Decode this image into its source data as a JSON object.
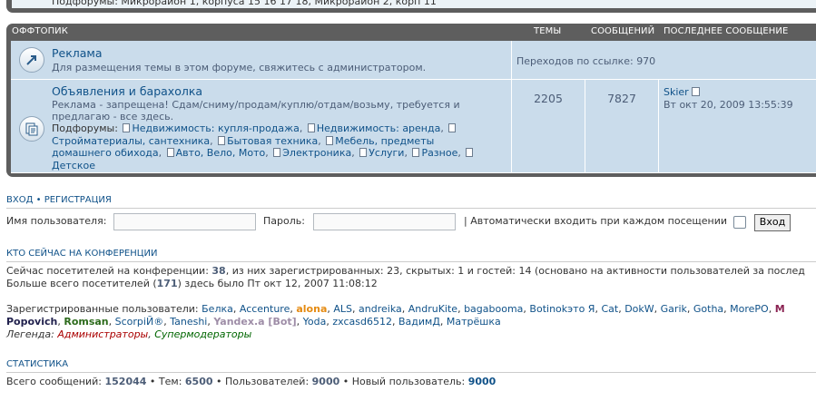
{
  "top_remnant": {
    "text": "Подфорумы:  Микрорайон 1, корпуса 15 16 17 18,  Микрорайон 2, корп 11"
  },
  "category": {
    "title": "Оффтопик",
    "col_topics": "Темы",
    "col_posts": "Сообщений",
    "col_last": "Последнее сообщение"
  },
  "forums": [
    {
      "title": "Реклама",
      "description": "Для размещения темы в этом форуме, свяжитесь с администратором.",
      "redirects": "Переходов по ссылке: 970"
    },
    {
      "title": "Объявления и барахолка",
      "description_line1": "Реклама - запрещена! Сдам/сниму/продам/куплю/отдам/возьму, требуется и",
      "description_line2": "предлагаю - все здесь.",
      "subforums_label": "Подфорумы:",
      "subforums": [
        "Недвижимость: купля-продажа",
        "Недвижимость: аренда",
        "Стройматериалы, сантехника",
        "Бытовая техника",
        "Мебель, предметы домашнего обихода",
        "Авто, Вело, Мото",
        "Электроника",
        "Услуги",
        "Разное",
        "Детское"
      ],
      "topics": "2205",
      "posts": "7827",
      "last_author": "Skier",
      "last_date": "Вт окт 20, 2009 13:55:39"
    }
  ],
  "login": {
    "title_login": "Вход",
    "sep": "•",
    "title_register": "Регистрация",
    "username_label": "Имя пользователя:",
    "password_label": "Пароль:",
    "autologin_label": "| Автоматически входить при каждом посещении",
    "submit": "Вход"
  },
  "online": {
    "title": "Кто сейчас на конференции",
    "line1_pre": "Сейчас посетителей на конференции: ",
    "line1_total": "38",
    "line1_post": ", из них зарегистрированных: 23, скрытых: 1 и гостей: 14 (основано на активности пользователей за послед",
    "line2_pre": "Больше всего посетителей (",
    "line2_max": "171",
    "line2_post": ") здесь было Пт окт 12, 2007 11:08:12",
    "registered_label": "Зарегистрированные пользователи: ",
    "users_row1": [
      {
        "name": "Белка",
        "color": "#105289",
        "bold": false
      },
      {
        "name": "Accenture",
        "color": "#105289",
        "bold": false
      },
      {
        "name": "alona",
        "color": "#e58b13",
        "bold": true
      },
      {
        "name": "ALS",
        "color": "#105289",
        "bold": false
      },
      {
        "name": "andreika",
        "color": "#105289",
        "bold": false
      },
      {
        "name": "AndruKite",
        "color": "#105289",
        "bold": false
      },
      {
        "name": "bagabooma",
        "color": "#105289",
        "bold": false
      },
      {
        "name": "Botinokэто Я",
        "color": "#105289",
        "bold": false
      },
      {
        "name": "Cat",
        "color": "#105289",
        "bold": false
      },
      {
        "name": "DokW",
        "color": "#105289",
        "bold": false
      },
      {
        "name": "Garik",
        "color": "#105289",
        "bold": false
      },
      {
        "name": "Gotha",
        "color": "#105289",
        "bold": false
      },
      {
        "name": "MorePO",
        "color": "#105289",
        "bold": false
      },
      {
        "name": "M",
        "color": "#8a2252",
        "bold": true
      }
    ],
    "users_row2": [
      {
        "name": "Popovich",
        "color": "#22224e",
        "bold": true
      },
      {
        "name": "Romsan",
        "color": "#2d6b1c",
        "bold": true
      },
      {
        "name": "ScorpiЙ®",
        "color": "#105289",
        "bold": false
      },
      {
        "name": "Taneshi",
        "color": "#105289",
        "bold": false
      },
      {
        "name": "Yandex.a [Bot]",
        "color": "#9e8da7",
        "bold": true
      },
      {
        "name": "Yoda",
        "color": "#105289",
        "bold": false
      },
      {
        "name": "zxcasd6512",
        "color": "#105289",
        "bold": false
      },
      {
        "name": "ВадимД",
        "color": "#105289",
        "bold": false
      },
      {
        "name": "Матрёшка",
        "color": "#105289",
        "bold": false
      }
    ],
    "legend_label": "Легенда: ",
    "legend_admins": "Администраторы",
    "legend_admins_color": "#aa0000",
    "legend_sep": ", ",
    "legend_mods": "Супермодераторы",
    "legend_mods_color": "#006600"
  },
  "stats": {
    "title": "Статистика",
    "posts_label": "Всего сообщений: ",
    "posts": "152044",
    "topics_label": " • Тем: ",
    "topics": "6500",
    "users_label": " • Пользователей: ",
    "users": "9000",
    "newest_label": " • Новый пользователь: ",
    "newest": "9000"
  }
}
